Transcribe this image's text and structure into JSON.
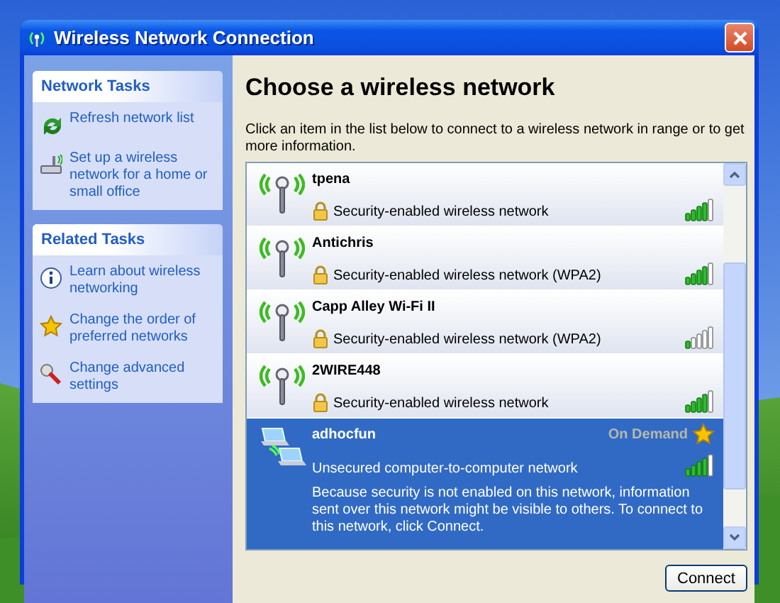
{
  "window": {
    "title": "Wireless Network Connection"
  },
  "sidebar": [
    {
      "title": "Network Tasks",
      "items": [
        {
          "label": "Refresh network list"
        },
        {
          "label": "Set up a wireless network for a home or small office"
        }
      ]
    },
    {
      "title": "Related Tasks",
      "items": [
        {
          "label": "Learn about wireless networking"
        },
        {
          "label": "Change the order of preferred networks"
        },
        {
          "label": "Change advanced settings"
        }
      ]
    }
  ],
  "heading": "Choose a wireless network",
  "description": "Click an item in the list below to connect to a wireless network in range or to get more information.",
  "networks": [
    {
      "kind": "access_point",
      "name": "tpena",
      "security": "Security-enabled wireless network",
      "secured": true,
      "preferred": false,
      "selected": false
    },
    {
      "kind": "access_point",
      "name": "Antichris",
      "security": "Security-enabled wireless network (WPA2)",
      "secured": true,
      "preferred": false,
      "selected": false
    },
    {
      "kind": "access_point",
      "name": "Capp Alley Wi-Fi II",
      "security": "Security-enabled wireless network (WPA2)",
      "secured": true,
      "preferred": false,
      "selected": false
    },
    {
      "kind": "access_point",
      "name": "2WIRE448",
      "security": "Security-enabled wireless network",
      "secured": true,
      "preferred": false,
      "selected": false
    },
    {
      "kind": "adhoc",
      "name": "adhocfun",
      "status": "On Demand",
      "security": "Unsecured computer-to-computer network",
      "secured": false,
      "preferred": true,
      "selected": true,
      "details": "Because security is not enabled on this network, information sent over this network might be visible to others. To connect to this network, click Connect."
    }
  ],
  "buttons": [
    "Connect"
  ]
}
